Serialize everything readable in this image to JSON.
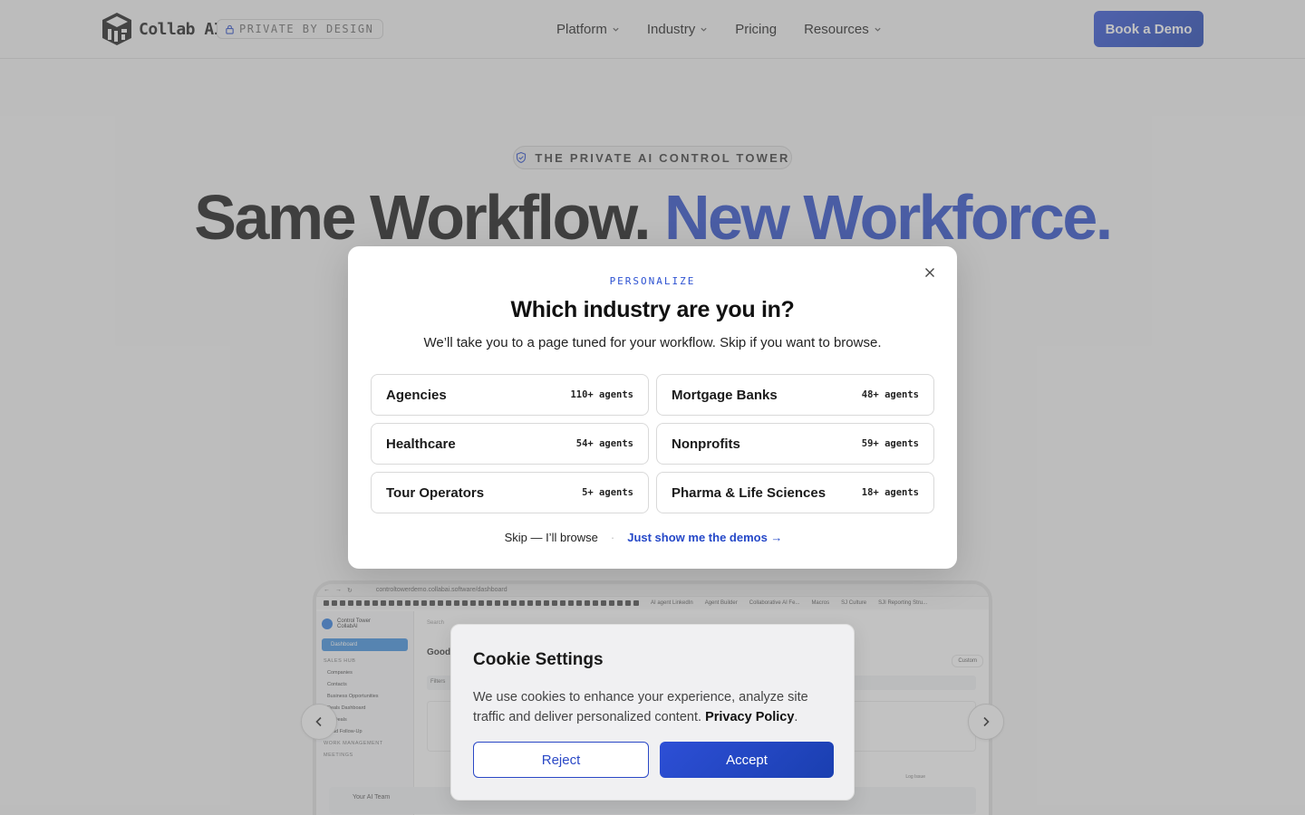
{
  "header": {
    "logo_text": "Collab AI",
    "badge": "PRIVATE BY DESIGN",
    "nav": [
      {
        "label": "Platform",
        "icon": "chevron-down-icon"
      },
      {
        "label": "Industry",
        "icon": "chevron-down-icon"
      },
      {
        "label": "Pricing"
      },
      {
        "label": "Resources",
        "icon": "chevron-down-icon"
      }
    ],
    "cta": "Book a Demo"
  },
  "hero": {
    "eyebrow": "THE PRIVATE AI CONTROL TOWER",
    "title_part1": "Same Workflow.",
    "title_part2": "New Workforce."
  },
  "preview": {
    "url": "controltowerdemo.collabai.software/dashboard",
    "app_name": "Control Tower",
    "app_sub": "CollabAI",
    "nav_active": "Dashboard",
    "nav_items": [
      "SALES HUB",
      "Companies",
      "Contacts",
      "Business Opportunities",
      "Deals Dashboard",
      "All Deals",
      "Lead Follow-Up",
      "WORK MANAGEMENT",
      "MEETINGS"
    ],
    "search": "Search",
    "greeting": "Good",
    "filters": "Filters",
    "custom": "Custom",
    "log": "Log Issue",
    "ai_team": "Your AI Team",
    "bookmarks": [
      "AI agent LinkedIn",
      "Agent Builder",
      "Collaborative AI Fe...",
      "Macros",
      "SJ Culture",
      "SJI Reporting Stru..."
    ]
  },
  "modal": {
    "eyebrow": "PERSONALIZE",
    "title": "Which industry are you in?",
    "subtitle": "We’ll take you to a page tuned for your workflow. Skip if you want to browse.",
    "options": [
      {
        "name": "Agencies",
        "count": "110+ agents"
      },
      {
        "name": "Mortgage Banks",
        "count": "48+ agents"
      },
      {
        "name": "Healthcare",
        "count": "54+ agents"
      },
      {
        "name": "Nonprofits",
        "count": "59+ agents"
      },
      {
        "name": "Tour Operators",
        "count": "5+ agents"
      },
      {
        "name": "Pharma & Life Sciences",
        "count": "18+ agents"
      }
    ],
    "skip": "Skip — I’ll browse",
    "separator": "·",
    "demos": "Just show me the demos →"
  },
  "cookie": {
    "title": "Cookie Settings",
    "text": "We use cookies to enhance your experience, analyze site traffic and deliver personalized content.",
    "policy": "Privacy Policy",
    "reject": "Reject",
    "accept": "Accept"
  },
  "colors": {
    "accent": "#2548c8",
    "button_gradient_start": "#2d4fd6",
    "button_gradient_end": "#1a3fb0",
    "overlay": "rgba(120,120,120,0.45)"
  }
}
